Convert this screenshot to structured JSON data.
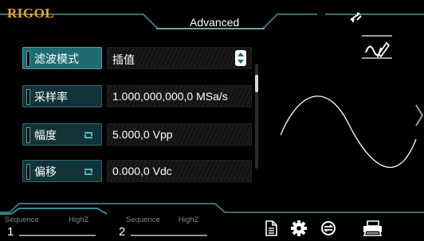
{
  "header": {
    "logo": "RIGOL",
    "mode_title": "Advanced"
  },
  "params": [
    {
      "label": "滤波模式",
      "value": "插值",
      "active": true,
      "has_dropdown": true,
      "has_cycle": false
    },
    {
      "label": "采样率",
      "value": "1.000,000,000,0 MSa/s",
      "active": false,
      "has_dropdown": false,
      "has_cycle": false
    },
    {
      "label": "幅度",
      "value": "5.000,0 Vpp",
      "active": false,
      "has_dropdown": false,
      "has_cycle": true
    },
    {
      "label": "偏移",
      "value": "0.000,0 Vdc",
      "active": false,
      "has_dropdown": false,
      "has_cycle": true
    }
  ],
  "channels": [
    {
      "number": "1",
      "mode": "Sequence",
      "impedance": "HighZ",
      "active": true
    },
    {
      "number": "2",
      "mode": "Sequence",
      "impedance": "HighZ",
      "active": false
    }
  ],
  "icons": {
    "sync": "sync-arrows-icon",
    "edit": "edit-pen-icon",
    "file": "file-icon",
    "settings": "gear-icon",
    "counter": "counter-icon",
    "print": "print-icon"
  },
  "colors": {
    "accent_teal": "#1f6b72",
    "frame": "#3d6f76",
    "logo": "#f0a41c"
  }
}
